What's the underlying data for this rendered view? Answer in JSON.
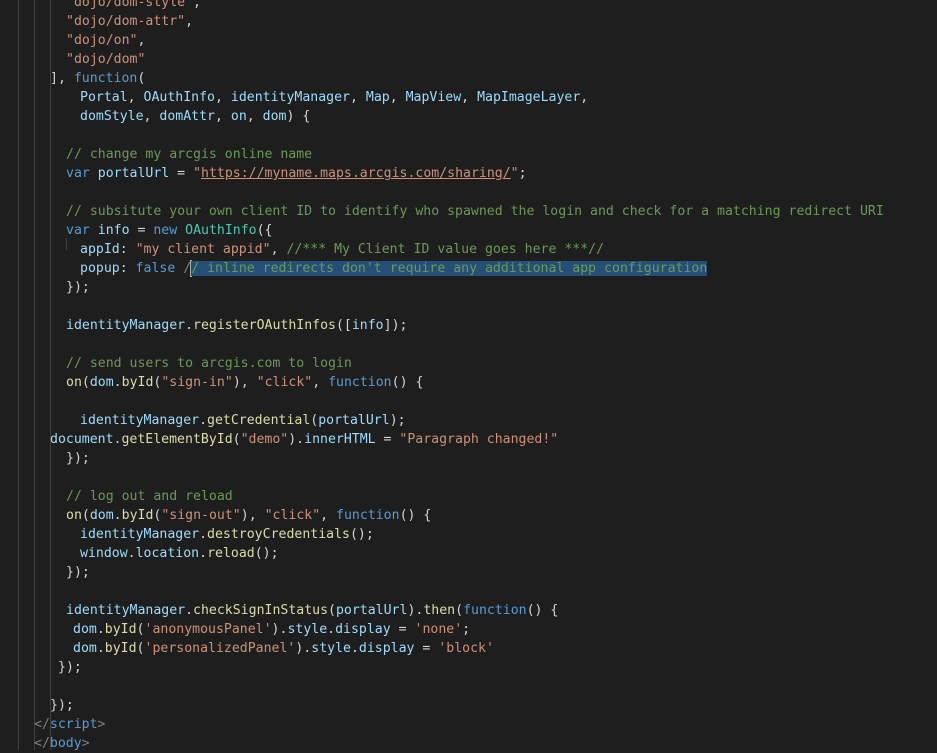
{
  "editor": {
    "language": "javascript",
    "lines": [
      {
        "tokens": [
          [
            "str",
            "\"dojo/dom-style\""
          ],
          [
            "punct",
            ","
          ]
        ]
      },
      {
        "tokens": [
          [
            "str",
            "\"dojo/dom-attr\""
          ],
          [
            "punct",
            ","
          ]
        ]
      },
      {
        "tokens": [
          [
            "str",
            "\"dojo/on\""
          ],
          [
            "punct",
            ","
          ]
        ]
      },
      {
        "tokens": [
          [
            "str",
            "\"dojo/dom\""
          ]
        ]
      },
      {
        "tokens": [
          [
            "punct",
            "], "
          ],
          [
            "kw",
            "function"
          ],
          [
            "punct",
            "("
          ]
        ]
      },
      {
        "tokens": [
          [
            "var",
            "Portal"
          ],
          [
            "punct",
            ", "
          ],
          [
            "var",
            "OAuthInfo"
          ],
          [
            "punct",
            ", "
          ],
          [
            "var",
            "identityManager"
          ],
          [
            "punct",
            ", "
          ],
          [
            "var",
            "Map"
          ],
          [
            "punct",
            ", "
          ],
          [
            "var",
            "MapView"
          ],
          [
            "punct",
            ", "
          ],
          [
            "var",
            "MapImageLayer"
          ],
          [
            "punct",
            ","
          ]
        ]
      },
      {
        "tokens": [
          [
            "var",
            "domStyle"
          ],
          [
            "punct",
            ", "
          ],
          [
            "var",
            "domAttr"
          ],
          [
            "punct",
            ", "
          ],
          [
            "var",
            "on"
          ],
          [
            "punct",
            ", "
          ],
          [
            "var",
            "dom"
          ],
          [
            "punct",
            ") {"
          ]
        ]
      },
      {
        "tokens": []
      },
      {
        "tokens": [
          [
            "com",
            "// change my arcgis online name"
          ]
        ]
      },
      {
        "tokens": [
          [
            "kw",
            "var "
          ],
          [
            "var",
            "portalUrl"
          ],
          [
            "punct",
            " = "
          ],
          [
            "str",
            "\""
          ],
          [
            "url",
            "https://myname.maps.arcgis.com/sharing/"
          ],
          [
            "str",
            "\""
          ],
          [
            "punct",
            ";"
          ]
        ]
      },
      {
        "tokens": []
      },
      {
        "tokens": [
          [
            "com",
            "// subsitute your own client ID to identify who spawned the login and check for a matching redirect URI"
          ]
        ]
      },
      {
        "tokens": [
          [
            "kw",
            "var "
          ],
          [
            "var",
            "info"
          ],
          [
            "punct",
            " = "
          ],
          [
            "kw",
            "new "
          ],
          [
            "cls",
            "OAuthInfo"
          ],
          [
            "punct",
            "({"
          ]
        ]
      },
      {
        "tokens": [
          [
            "var",
            "appId"
          ],
          [
            "punct",
            ": "
          ],
          [
            "str",
            "\"my client appid\""
          ],
          [
            "punct",
            ", "
          ],
          [
            "com",
            "//*** My Client ID value goes here ***//"
          ]
        ]
      },
      {
        "tokens": [
          [
            "var",
            "popup"
          ],
          [
            "punct",
            ": "
          ],
          [
            "kw",
            "false"
          ],
          [
            "punct",
            " "
          ],
          [
            "com",
            "/"
          ],
          [
            "cursor",
            ""
          ],
          [
            "comsel",
            "/ inline redirects don't require any additional app configuration"
          ]
        ]
      },
      {
        "tokens": [
          [
            "punct",
            "});"
          ]
        ]
      },
      {
        "tokens": []
      },
      {
        "tokens": [
          [
            "var",
            "identityManager"
          ],
          [
            "punct",
            "."
          ],
          [
            "fn",
            "registerOAuthInfos"
          ],
          [
            "punct",
            "(["
          ],
          [
            "var",
            "info"
          ],
          [
            "punct",
            "]);"
          ]
        ]
      },
      {
        "tokens": []
      },
      {
        "tokens": [
          [
            "com",
            "// send users to arcgis.com to login"
          ]
        ]
      },
      {
        "tokens": [
          [
            "fn",
            "on"
          ],
          [
            "punct",
            "("
          ],
          [
            "var",
            "dom"
          ],
          [
            "punct",
            "."
          ],
          [
            "fn",
            "byId"
          ],
          [
            "punct",
            "("
          ],
          [
            "str",
            "\"sign-in\""
          ],
          [
            "punct",
            "), "
          ],
          [
            "str",
            "\"click\""
          ],
          [
            "punct",
            ", "
          ],
          [
            "kw",
            "function"
          ],
          [
            "punct",
            "() {"
          ]
        ]
      },
      {
        "tokens": []
      },
      {
        "tokens": [
          [
            "var",
            "identityManager"
          ],
          [
            "punct",
            "."
          ],
          [
            "fn",
            "getCredential"
          ],
          [
            "punct",
            "("
          ],
          [
            "var",
            "portalUrl"
          ],
          [
            "punct",
            ");"
          ]
        ]
      },
      {
        "tokens": [
          [
            "var",
            "document"
          ],
          [
            "punct",
            "."
          ],
          [
            "fn",
            "getElementById"
          ],
          [
            "punct",
            "("
          ],
          [
            "str",
            "\"demo\""
          ],
          [
            "punct",
            ")."
          ],
          [
            "var",
            "innerHTML"
          ],
          [
            "punct",
            " = "
          ],
          [
            "str",
            "\"Paragraph changed!\""
          ]
        ]
      },
      {
        "tokens": [
          [
            "punct",
            "});"
          ]
        ]
      },
      {
        "tokens": []
      },
      {
        "tokens": [
          [
            "com",
            "// log out and reload"
          ]
        ]
      },
      {
        "tokens": [
          [
            "fn",
            "on"
          ],
          [
            "punct",
            "("
          ],
          [
            "var",
            "dom"
          ],
          [
            "punct",
            "."
          ],
          [
            "fn",
            "byId"
          ],
          [
            "punct",
            "("
          ],
          [
            "str",
            "\"sign-out\""
          ],
          [
            "punct",
            "), "
          ],
          [
            "str",
            "\"click\""
          ],
          [
            "punct",
            ", "
          ],
          [
            "kw",
            "function"
          ],
          [
            "punct",
            "() {"
          ]
        ]
      },
      {
        "tokens": [
          [
            "var",
            "identityManager"
          ],
          [
            "punct",
            "."
          ],
          [
            "fn",
            "destroyCredentials"
          ],
          [
            "punct",
            "();"
          ]
        ]
      },
      {
        "tokens": [
          [
            "var",
            "window"
          ],
          [
            "punct",
            "."
          ],
          [
            "var",
            "location"
          ],
          [
            "punct",
            "."
          ],
          [
            "fn",
            "reload"
          ],
          [
            "punct",
            "();"
          ]
        ]
      },
      {
        "tokens": [
          [
            "punct",
            "});"
          ]
        ]
      },
      {
        "tokens": []
      },
      {
        "tokens": [
          [
            "var",
            "identityManager"
          ],
          [
            "punct",
            "."
          ],
          [
            "fn",
            "checkSignInStatus"
          ],
          [
            "punct",
            "("
          ],
          [
            "var",
            "portalUrl"
          ],
          [
            "punct",
            ")."
          ],
          [
            "fn",
            "then"
          ],
          [
            "punct",
            "("
          ],
          [
            "kw",
            "function"
          ],
          [
            "punct",
            "() {"
          ]
        ]
      },
      {
        "tokens": [
          [
            "var",
            "dom"
          ],
          [
            "punct",
            "."
          ],
          [
            "fn",
            "byId"
          ],
          [
            "punct",
            "("
          ],
          [
            "str",
            "'anonymousPanel'"
          ],
          [
            "punct",
            ")."
          ],
          [
            "var",
            "style"
          ],
          [
            "punct",
            "."
          ],
          [
            "var",
            "display"
          ],
          [
            "punct",
            " = "
          ],
          [
            "str",
            "'none'"
          ],
          [
            "punct",
            ";"
          ]
        ]
      },
      {
        "tokens": [
          [
            "var",
            "dom"
          ],
          [
            "punct",
            "."
          ],
          [
            "fn",
            "byId"
          ],
          [
            "punct",
            "("
          ],
          [
            "str",
            "'personalizedPanel'"
          ],
          [
            "punct",
            ")."
          ],
          [
            "var",
            "style"
          ],
          [
            "punct",
            "."
          ],
          [
            "var",
            "display"
          ],
          [
            "punct",
            " = "
          ],
          [
            "str",
            "'block'"
          ]
        ]
      },
      {
        "tokens": [
          [
            "punct",
            "});"
          ]
        ]
      },
      {
        "tokens": []
      },
      {
        "tokens": [
          [
            "punct",
            "});"
          ]
        ]
      },
      {
        "tokens": [
          [
            "tagbr",
            "</"
          ],
          [
            "tag",
            "script"
          ],
          [
            "tagbr",
            ">"
          ]
        ]
      },
      {
        "tokens": [
          [
            "tagbr",
            "</"
          ],
          [
            "tag",
            "body"
          ],
          [
            "tagbr",
            ">"
          ]
        ]
      }
    ]
  }
}
